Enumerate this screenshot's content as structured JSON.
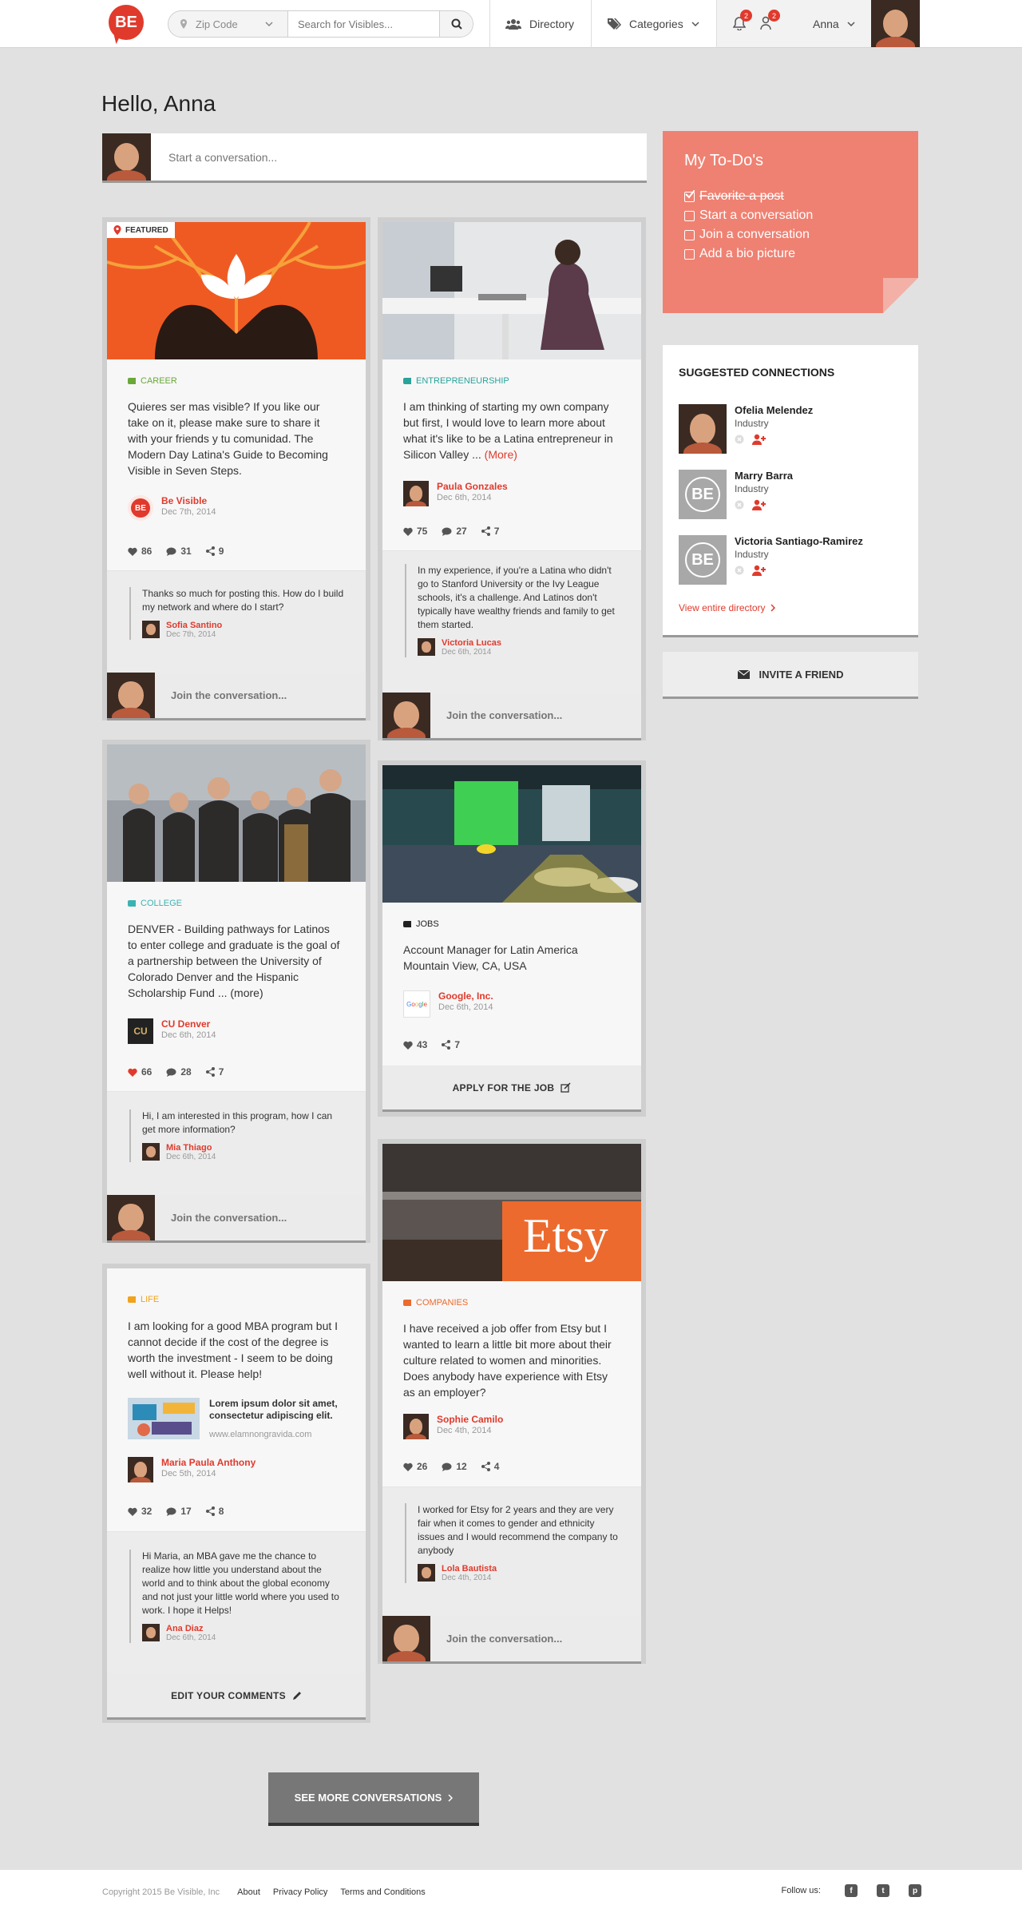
{
  "nav": {
    "logo": "BE",
    "zip_placeholder": "Zip Code",
    "search_placeholder": "Search for Visibles...",
    "directory": "Directory",
    "categories": "Categories",
    "notif_count": "2",
    "friend_count": "2",
    "user": "Anna"
  },
  "greeting": "Hello, Anna",
  "composer_placeholder": "Start a conversation...",
  "join_placeholder": "Join the conversation...",
  "posts": {
    "p1": {
      "badge": "FEATURED",
      "category": "CAREER",
      "text": "Quieres ser mas visible? If you like our take on it, please make sure to share it with your friends y tu comunidad. The Modern Day Latina's Guide to Becoming Visible in Seven Steps.",
      "author": "Be Visible",
      "date": "Dec 7th, 2014",
      "likes": "86",
      "comments": "31",
      "shares": "9",
      "c_text": "Thanks so much for posting this. How do I build my network and where do I start?",
      "c_author": "Sofia Santino",
      "c_date": "Dec 7th, 2014"
    },
    "p2": {
      "category": "ENTREPRENEURSHIP",
      "text": "I am thinking of starting my own company but first, I would love to learn more about what it's like to be a Latina entrepreneur in Silicon Valley ...",
      "more": "(More)",
      "author": "Paula Gonzales",
      "date": "Dec 6th, 2014",
      "likes": "75",
      "comments": "27",
      "shares": "7",
      "c_text": "In my experience, if you're a Latina who didn't go to Stanford University or the Ivy League schools, it's a challenge. And Latinos don't typically have wealthy friends and family to get them started.",
      "c_author": "Victoria Lucas",
      "c_date": "Dec 6th, 2014"
    },
    "p3": {
      "category": "COLLEGE",
      "text": "DENVER - Building pathways for Latinos to enter college and graduate is the goal of a partnership between the University of Colorado Denver and the Hispanic Scholarship Fund ... (more)",
      "author": "CU Denver",
      "date": "Dec 6th, 2014",
      "likes": "66",
      "comments": "28",
      "shares": "7",
      "c_text": "Hi, I am interested in this program, how I can get more information?",
      "c_author": "Mia Thiago",
      "c_date": "Dec 6th, 2014"
    },
    "p4": {
      "category": "JOBS",
      "title": "Account Manager for Latin America",
      "location": "Mountain View, CA, USA",
      "author": "Google, Inc.",
      "date": "Dec 6th, 2014",
      "likes": "43",
      "shares": "7",
      "action": "APPLY FOR THE JOB"
    },
    "p5": {
      "category": "LIFE",
      "text": "I am looking for a good MBA program but I cannot decide if the cost of the degree is worth the investment - I seem to be doing well without it. Please help!",
      "link_title": "Lorem ipsum dolor sit amet, consectetur adipiscing elit.",
      "link_url": "www.elamnongravida.com",
      "author": "Maria Paula Anthony",
      "date": "Dec 5th, 2014",
      "likes": "32",
      "comments": "17",
      "shares": "8",
      "c_text": "Hi Maria, an MBA gave me the chance to realize how little you understand about the world and to think about the global economy and not just your little world where you used to work. I hope it Helps!",
      "c_author": "Ana Diaz",
      "c_date": "Dec 6th, 2014",
      "action": "EDIT YOUR COMMENTS"
    },
    "p6": {
      "image_text": "Etsy",
      "category": "COMPANIES",
      "text": "I have received a job offer from Etsy but I wanted to learn a little bit more about their culture related to women and minorities. Does anybody have experience with Etsy as an employer?",
      "author": "Sophie Camilo",
      "date": "Dec 4th, 2014",
      "likes": "26",
      "comments": "12",
      "shares": "4",
      "c_text": "I worked for Etsy for 2 years and they are very fair when it comes to gender and ethnicity issues and I would recommend the company to anybody",
      "c_author": "Lola Bautista",
      "c_date": "Dec 4th, 2014"
    }
  },
  "todo": {
    "title": "My To-Do's",
    "items": [
      "Favorite a post",
      "Start a conversation",
      "Join a conversation",
      "Add a bio picture"
    ]
  },
  "suggested": {
    "title": "SUGGESTED CONNECTIONS",
    "people": [
      {
        "name": "Ofelia Melendez",
        "industry": "Industry"
      },
      {
        "name": "Marry Barra",
        "industry": "Industry"
      },
      {
        "name": "Victoria Santiago-Ramirez",
        "industry": "Industry"
      }
    ],
    "view_all": "View entire directory"
  },
  "invite": "INVITE A FRIEND",
  "see_more": "SEE MORE CONVERSATIONS",
  "footer": {
    "copyright": "Copyright 2015 Be Visible, Inc",
    "links": [
      "About",
      "Privacy Policy",
      "Terms and Conditions"
    ],
    "follow": "Follow us:"
  },
  "colors": {
    "accent": "#e03a2c",
    "todo": "#ef8172",
    "career": "#6aa83a",
    "entrepreneurship": "#2aa39a",
    "college": "#3bb3b3",
    "life": "#f0a31b",
    "companies": "#ec6a2e",
    "jobs": "#222222"
  },
  "icons": [
    "search-icon",
    "users-icon",
    "tags-icon",
    "bell-icon",
    "user-add-icon",
    "heart-icon",
    "comment-icon",
    "share-icon",
    "envelope-icon",
    "edit-icon",
    "facebook-icon",
    "twitter-icon",
    "pinterest-icon"
  ]
}
